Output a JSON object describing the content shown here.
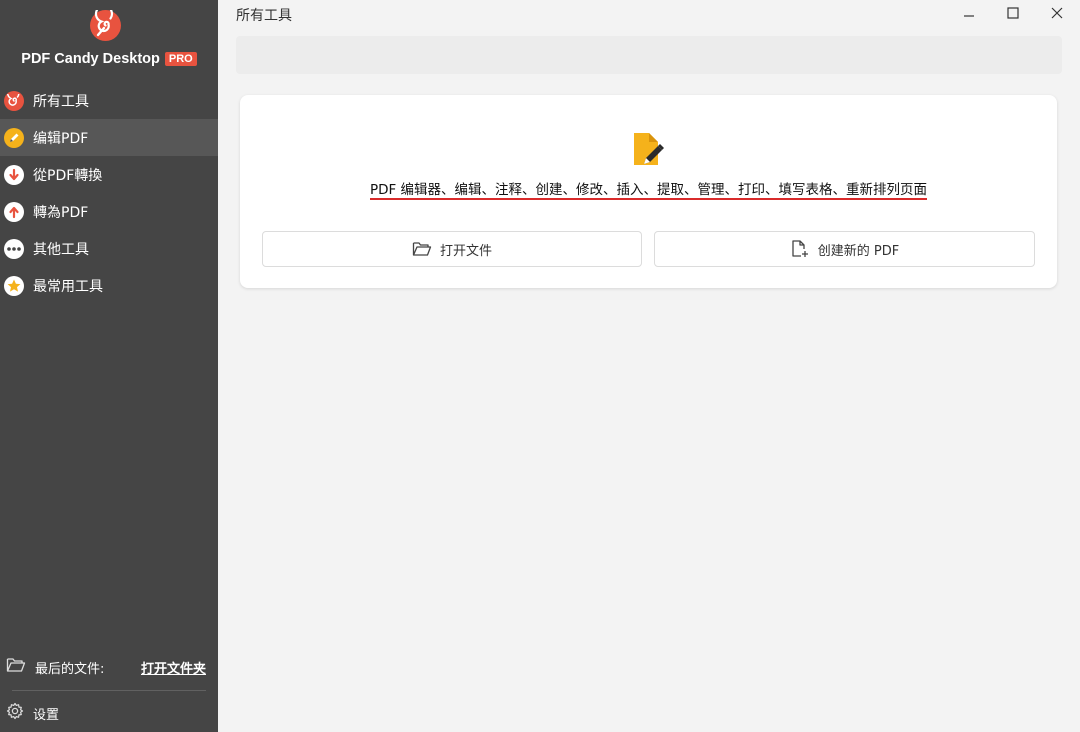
{
  "app": {
    "name": "PDF Candy Desktop",
    "badge": "PRO"
  },
  "sidebar": {
    "items": [
      {
        "label": "所有工具",
        "icon": "spiral-icon",
        "color": "#e8533f",
        "active": false
      },
      {
        "label": "编辑PDF",
        "icon": "pencil-icon",
        "color": "#f5b21b",
        "active": true
      },
      {
        "label": "從PDF轉換",
        "icon": "arrow-down-icon",
        "color": "#e8533f",
        "active": false
      },
      {
        "label": "轉為PDF",
        "icon": "arrow-up-icon",
        "color": "#e8533f",
        "active": false
      },
      {
        "label": "其他工具",
        "icon": "more-dots-icon",
        "color": "#ffffff",
        "active": false
      },
      {
        "label": "最常用工具",
        "icon": "star-icon",
        "color": "#f5b21b",
        "active": false
      }
    ],
    "recent_label": "最后的文件:",
    "open_folder": "打开文件夹",
    "settings": "设置"
  },
  "header": {
    "title": "所有工具"
  },
  "card": {
    "description": "PDF 编辑器、编辑、注释、创建、修改、插入、提取、管理、打印、填写表格、重新排列页面",
    "open_file": "打开文件",
    "create_pdf": "创建新的 PDF"
  },
  "colors": {
    "sidebar_bg": "#454545",
    "brand": "#e8533f",
    "accent_yellow": "#f5b21b",
    "underline": "#d92b2b"
  }
}
